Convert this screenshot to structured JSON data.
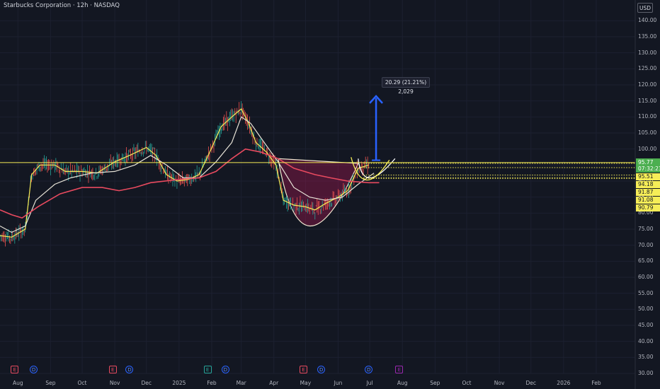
{
  "header": {
    "title": "Starbucks Corporation · 12h · NASDAQ",
    "currency": "USD"
  },
  "chart_data": {
    "type": "line",
    "xlim": [
      "2024-07-15",
      "2026-03-10"
    ],
    "ylim": [
      30,
      142.5
    ],
    "y_ticks": [
      "140.00",
      "135.00",
      "130.00",
      "125.00",
      "120.00",
      "115.00",
      "110.00",
      "105.00",
      "100.00",
      "95.00",
      "90.00",
      "85.00",
      "80.00",
      "75.00",
      "70.00",
      "65.00",
      "60.00",
      "55.00",
      "50.00",
      "45.00",
      "40.00",
      "35.00",
      "30.00"
    ],
    "x_ticks": [
      {
        "label": "Aug",
        "date": "2024-08-01"
      },
      {
        "label": "Sep",
        "date": "2024-09-01"
      },
      {
        "label": "Oct",
        "date": "2024-10-01"
      },
      {
        "label": "Nov",
        "date": "2024-11-01"
      },
      {
        "label": "Dec",
        "date": "2024-12-01"
      },
      {
        "label": "2025",
        "date": "2025-01-01"
      },
      {
        "label": "Feb",
        "date": "2025-02-01"
      },
      {
        "label": "Mar",
        "date": "2025-03-01"
      },
      {
        "label": "Apr",
        "date": "2025-04-01"
      },
      {
        "label": "May",
        "date": "2025-05-01"
      },
      {
        "label": "Jun",
        "date": "2025-06-01"
      },
      {
        "label": "Jul",
        "date": "2025-07-01"
      },
      {
        "label": "Aug",
        "date": "2025-08-01"
      },
      {
        "label": "Sep",
        "date": "2025-09-01"
      },
      {
        "label": "Oct",
        "date": "2025-10-01"
      },
      {
        "label": "Nov",
        "date": "2025-11-01"
      },
      {
        "label": "Dec",
        "date": "2025-12-01"
      },
      {
        "label": "2026",
        "date": "2026-01-01"
      },
      {
        "label": "Feb",
        "date": "2026-02-01"
      }
    ],
    "series": [
      {
        "color": "#f6ed57",
        "points": [
          [
            "2024-07-15",
            73
          ],
          [
            "2024-07-26",
            72.5
          ],
          [
            "2024-08-08",
            75
          ],
          [
            "2024-08-14",
            92
          ],
          [
            "2024-08-22",
            95
          ],
          [
            "2024-09-05",
            95
          ],
          [
            "2024-09-15",
            93
          ],
          [
            "2024-10-01",
            93
          ],
          [
            "2024-10-15",
            92.5
          ],
          [
            "2024-11-01",
            96
          ],
          [
            "2024-11-15",
            98
          ],
          [
            "2024-12-01",
            100.5
          ],
          [
            "2024-12-10",
            98
          ],
          [
            "2024-12-20",
            92
          ],
          [
            "2024-12-30",
            90
          ],
          [
            "2025-01-10",
            90.5
          ],
          [
            "2025-01-20",
            92
          ],
          [
            "2025-01-30",
            99
          ],
          [
            "2025-02-10",
            107
          ],
          [
            "2025-02-20",
            110
          ],
          [
            "2025-03-01",
            112.5
          ],
          [
            "2025-03-08",
            108
          ],
          [
            "2025-03-15",
            102
          ],
          [
            "2025-03-25",
            99
          ],
          [
            "2025-04-03",
            95
          ],
          [
            "2025-04-10",
            84
          ],
          [
            "2025-04-20",
            82.5
          ],
          [
            "2025-05-01",
            82
          ],
          [
            "2025-05-10",
            81
          ],
          [
            "2025-05-20",
            83
          ],
          [
            "2025-06-01",
            85
          ],
          [
            "2025-06-10",
            87
          ],
          [
            "2025-06-20",
            94
          ],
          [
            "2025-06-30",
            95
          ]
        ]
      },
      {
        "color": "#e8e4d8",
        "points": [
          [
            "2024-07-15",
            76
          ],
          [
            "2024-07-26",
            74
          ],
          [
            "2024-08-08",
            76
          ],
          [
            "2024-08-18",
            84
          ],
          [
            "2024-09-05",
            89
          ],
          [
            "2024-09-20",
            91
          ],
          [
            "2024-10-10",
            92.5
          ],
          [
            "2024-11-01",
            93
          ],
          [
            "2024-11-20",
            95
          ],
          [
            "2024-12-05",
            98
          ],
          [
            "2024-12-20",
            95
          ],
          [
            "2025-01-05",
            91
          ],
          [
            "2025-01-20",
            91
          ],
          [
            "2025-02-05",
            96
          ],
          [
            "2025-02-20",
            102
          ],
          [
            "2025-03-01",
            110
          ],
          [
            "2025-03-10",
            108
          ],
          [
            "2025-03-25",
            101
          ],
          [
            "2025-04-05",
            96
          ],
          [
            "2025-04-20",
            88
          ],
          [
            "2025-05-05",
            85
          ],
          [
            "2025-05-20",
            84
          ],
          [
            "2025-06-05",
            85
          ],
          [
            "2025-06-20",
            89
          ],
          [
            "2025-07-05",
            92.5
          ]
        ]
      },
      {
        "color": "#e84a5f",
        "points": [
          [
            "2024-07-15",
            81
          ],
          [
            "2024-07-26",
            79.5
          ],
          [
            "2024-08-05",
            78.5
          ],
          [
            "2024-08-20",
            82
          ],
          [
            "2024-09-10",
            86
          ],
          [
            "2024-10-01",
            88
          ],
          [
            "2024-10-20",
            88
          ],
          [
            "2024-11-05",
            87
          ],
          [
            "2024-11-20",
            88
          ],
          [
            "2024-12-05",
            89.5
          ],
          [
            "2025-01-01",
            90.5
          ],
          [
            "2025-01-20",
            91
          ],
          [
            "2025-02-05",
            93
          ],
          [
            "2025-02-20",
            97
          ],
          [
            "2025-03-05",
            100
          ],
          [
            "2025-03-20",
            99
          ],
          [
            "2025-04-05",
            97
          ],
          [
            "2025-04-20",
            94
          ],
          [
            "2025-05-10",
            92
          ],
          [
            "2025-05-25",
            91
          ],
          [
            "2025-06-10",
            90
          ],
          [
            "2025-06-30",
            89.5
          ],
          [
            "2025-07-10",
            89.5
          ]
        ]
      }
    ],
    "cup_pattern": {
      "color": "#c2185b",
      "start": [
        "2025-04-05",
        97
      ],
      "bottom": [
        "2025-05-05",
        76
      ],
      "end": [
        "2025-06-20",
        95.5
      ]
    },
    "handle_pattern": {
      "color": "#f6ed57",
      "start": [
        "2025-06-20",
        97
      ],
      "bottom": [
        "2025-07-01",
        91
      ],
      "end": [
        "2025-07-25",
        97
      ]
    },
    "projection_arrow": {
      "color": "#2962ff",
      "from": [
        "2025-07-07",
        96.5
      ],
      "to": [
        "2025-07-07",
        116.5
      ],
      "label": "20.29 (21.21%) 2,029"
    },
    "levels": [
      {
        "value": 95.77,
        "label": "95.77",
        "sublabel": "07:32:23",
        "color": "#4caf50",
        "line_color": "#f6ed57"
      },
      {
        "value": 95.51,
        "label": "95.51"
      },
      {
        "value": 94.18,
        "label": "94.18"
      },
      {
        "value": 91.87,
        "label": "91.87"
      },
      {
        "value": 91.08,
        "label": "91.08"
      },
      {
        "value": 90.79,
        "label": "90.79"
      }
    ],
    "events": [
      {
        "type": "E",
        "date": "2024-07-29",
        "color": "#e84a5f"
      },
      {
        "type": "D",
        "date": "2024-08-16"
      },
      {
        "type": "E",
        "date": "2024-10-30",
        "color": "#e84a5f"
      },
      {
        "type": "D",
        "date": "2024-11-15"
      },
      {
        "type": "E",
        "date": "2025-01-28",
        "color": "#26a69a"
      },
      {
        "type": "D",
        "date": "2025-02-14"
      },
      {
        "type": "E",
        "date": "2025-04-29",
        "color": "#e84a5f"
      },
      {
        "type": "D",
        "date": "2025-05-16"
      },
      {
        "type": "D",
        "date": "2025-06-30"
      },
      {
        "type": "E",
        "date": "2025-07-29",
        "color": "#9c27b0"
      }
    ]
  }
}
